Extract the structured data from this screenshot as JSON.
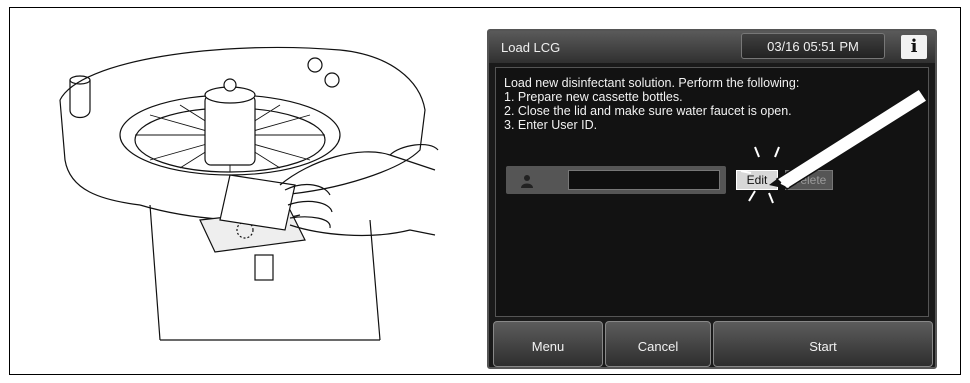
{
  "screen": {
    "title": "Load LCG",
    "datetime": "03/16 05:51 PM",
    "info_label": "i",
    "message_lines": [
      "Load new disinfectant solution. Perform the following:",
      "1. Prepare new cassette bottles.",
      "2. Close the lid and make sure water faucet is open.",
      "3. Enter User ID."
    ],
    "user_id_value": "",
    "edit_label": "Edit",
    "delete_label": "Delete",
    "buttons": {
      "menu": "Menu",
      "cancel": "Cancel",
      "start": "Start"
    }
  },
  "icons": [
    "user-icon",
    "info-icon",
    "stylus-icon",
    "card-reader-icon"
  ]
}
